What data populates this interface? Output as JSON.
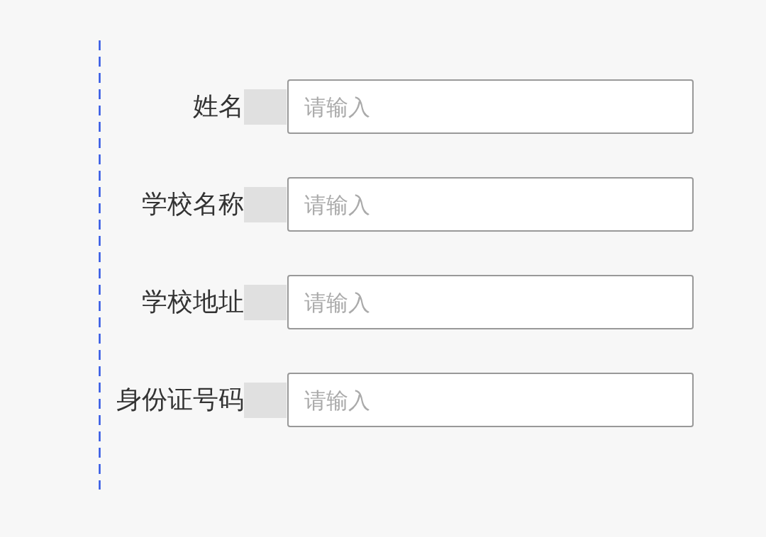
{
  "form": {
    "fields": [
      {
        "label": "姓名",
        "placeholder": "请输入"
      },
      {
        "label": "学校名称",
        "placeholder": "请输入"
      },
      {
        "label": "学校地址",
        "placeholder": "请输入"
      },
      {
        "label": "身份证号码",
        "placeholder": "请输入"
      }
    ]
  }
}
